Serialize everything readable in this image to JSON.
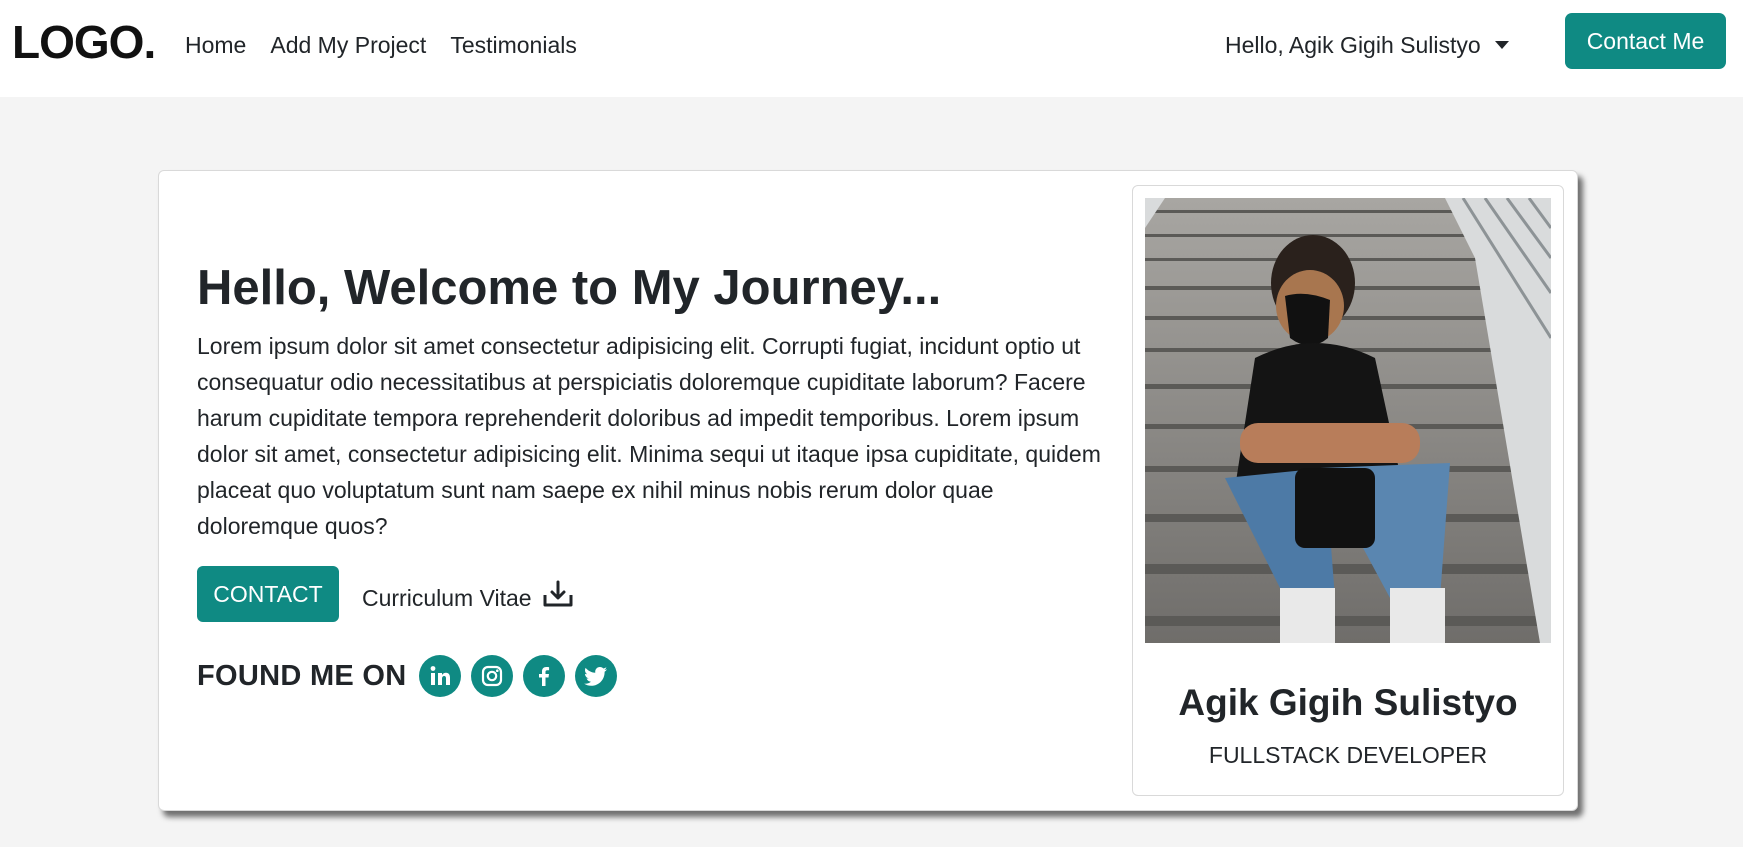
{
  "nav": {
    "logo": "LOGO.",
    "links": [
      "Home",
      "Add My Project",
      "Testimonials"
    ],
    "user_menu": "Hello, Agik Gigih Sulistyo",
    "contact_button": "Contact Me"
  },
  "hero": {
    "headline": "Hello, Welcome to My Journey...",
    "intro": "Lorem ipsum dolor sit amet consectetur adipisicing elit. Corrupti fugiat, incidunt optio ut consequatur odio necessitatibus at perspiciatis doloremque cupiditate laborum? Facere harum cupiditate tempora reprehenderit doloribus ad impedit temporibus. Lorem ipsum dolor sit amet, consectetur adipisicing elit. Minima sequi ut itaque ipsa cupiditate, quidem placeat quo voluptatum sunt nam saepe ex nihil minus nobis rerum dolor quae doloremque quos?",
    "contact_button": "CONTACT",
    "cv_link": "Curriculum Vitae",
    "found_me_label": "FOUND ME ON",
    "social_icons": [
      "linkedin-icon",
      "instagram-icon",
      "facebook-icon",
      "twitter-icon"
    ]
  },
  "profile": {
    "name": "Agik Gigih Sulistyo",
    "role": "FULLSTACK DEVELOPER"
  },
  "colors": {
    "accent": "#0f8a83",
    "background": "#f4f4f4"
  }
}
